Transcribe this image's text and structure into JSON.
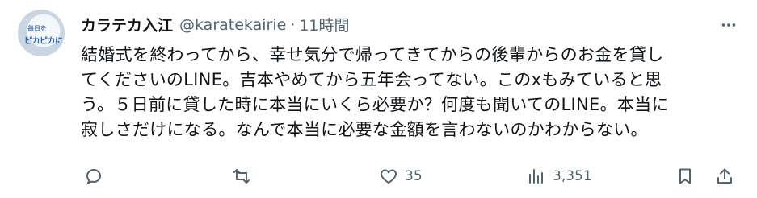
{
  "tweet": {
    "display_name": "カラテカ入江",
    "handle": "@karatekairie",
    "separator": "·",
    "time": "11時間",
    "avatar_text_top": "毎日を",
    "avatar_text_main": "ピカピカに",
    "lines": [
      "結婚式を終わってから、幸せ気分で帰ってきてからの後輩からのお金を貸し",
      "てくださいのLINE。吉本やめてから五年会ってない。このxもみていると思",
      "う。５日前に貸した時に本当にいくら必要か？何度も聞いてのLINE。本当に",
      "寂しさだけになる。なんで本当に必要な金額を言わないのかわからない。"
    ]
  },
  "actions": {
    "reply_count": "",
    "retweet_count": "",
    "like_count": "35",
    "views_count": "3,351"
  },
  "icons": {
    "more": "more-icon",
    "reply": "reply-icon",
    "retweet": "retweet-icon",
    "like": "heart-icon",
    "views": "views-icon",
    "bookmark": "bookmark-icon",
    "share": "share-icon"
  },
  "colors": {
    "text": "#0f1419",
    "secondary": "#536471"
  }
}
